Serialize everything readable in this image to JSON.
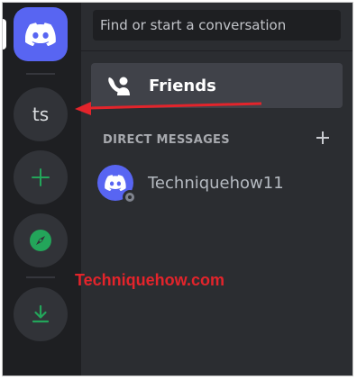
{
  "colors": {
    "rail_bg": "#1e1f22",
    "panel_bg": "#2b2d31",
    "discord_blurple": "#5865f2",
    "green_accent": "#23a55a",
    "selected_bg": "#404249",
    "annotation_red": "#e3242b"
  },
  "server_rail": {
    "items": [
      {
        "icon": "discord-logo-icon"
      },
      {
        "label": "ts"
      },
      {
        "icon": "plus-icon"
      },
      {
        "icon": "compass-icon"
      },
      {
        "icon": "download-icon"
      }
    ]
  },
  "search": {
    "placeholder": "Find or start a conversation"
  },
  "friends": {
    "label": "Friends",
    "icon": "friends-icon"
  },
  "direct_messages": {
    "header": "DIRECT MESSAGES",
    "add_icon": "plus-icon",
    "items": [
      {
        "name": "Techniquehow11",
        "status": "offline"
      }
    ]
  },
  "annotation": {
    "watermark": "Techniquehow.com"
  }
}
